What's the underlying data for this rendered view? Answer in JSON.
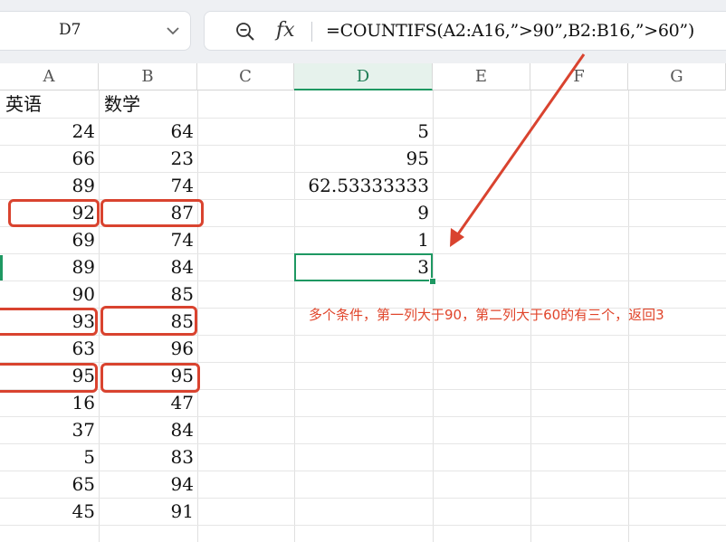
{
  "namebox": {
    "cell_ref": "D7"
  },
  "formula_bar": {
    "fx_label": "fx",
    "formula": "=COUNTIFS(A2:A16,”>90”,B2:B16,”>60”)"
  },
  "columns": [
    "A",
    "B",
    "C",
    "D",
    "E",
    "F",
    "G"
  ],
  "selected_column": "D",
  "sheet": {
    "header_a": "英语",
    "header_b": "数学",
    "col_a": [
      "24",
      "66",
      "89",
      "92",
      "69",
      "89",
      "90",
      "93",
      "63",
      "95",
      "16",
      "37",
      "5",
      "65",
      "45"
    ],
    "col_b": [
      "64",
      "23",
      "74",
      "87",
      "74",
      "84",
      "85",
      "85",
      "96",
      "95",
      "47",
      "84",
      "83",
      "94",
      "91"
    ],
    "col_d": [
      "5",
      "95",
      "62.53333333",
      "9",
      "1",
      "3"
    ]
  },
  "annotation": {
    "note": "多个条件，第一列大于90，第二列大于60的有三个，返回3",
    "color": "#d9432f"
  }
}
